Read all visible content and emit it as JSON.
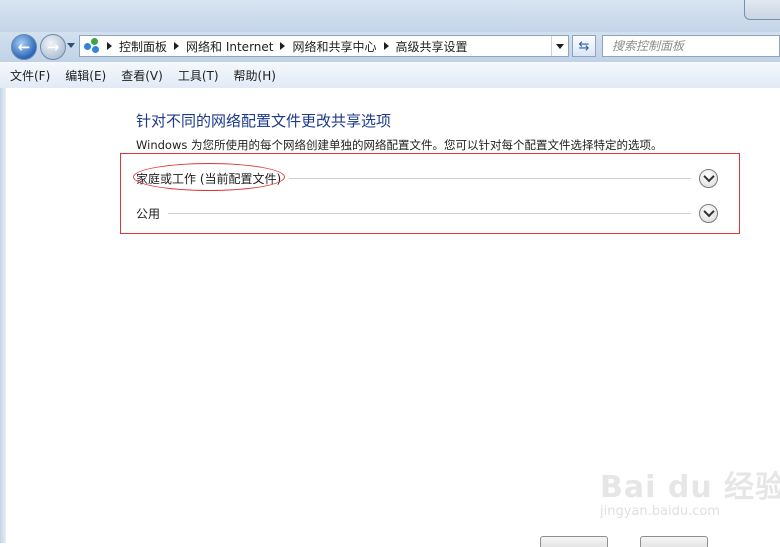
{
  "nav": {
    "back_icon": "back-arrow-icon",
    "forward_icon": "forward-arrow-icon",
    "back_glyph": "←",
    "forward_glyph": "→"
  },
  "address": {
    "breadcrumbs": [
      "控制面板",
      "网络和 Internet",
      "网络和共享中心",
      "高级共享设置"
    ]
  },
  "search": {
    "placeholder": "搜索控制面板"
  },
  "menu": [
    "文件(F)",
    "编辑(E)",
    "查看(V)",
    "工具(T)",
    "帮助(H)"
  ],
  "main": {
    "title": "针对不同的网络配置文件更改共享选项",
    "description": "Windows 为您所使用的每个网络创建单独的网络配置文件。您可以针对每个配置文件选择特定的选项。",
    "profiles": [
      {
        "label": "家庭或工作 (当前配置文件)",
        "expanded": false
      },
      {
        "label": "公用",
        "expanded": false
      }
    ]
  },
  "watermark": {
    "main": "Bai du 经验",
    "sub": "jingyan.baidu.com"
  },
  "colors": {
    "title": "#1c3a8c",
    "annotation_red": "#e2373a",
    "chrome_blue": "#c4d5e8"
  }
}
